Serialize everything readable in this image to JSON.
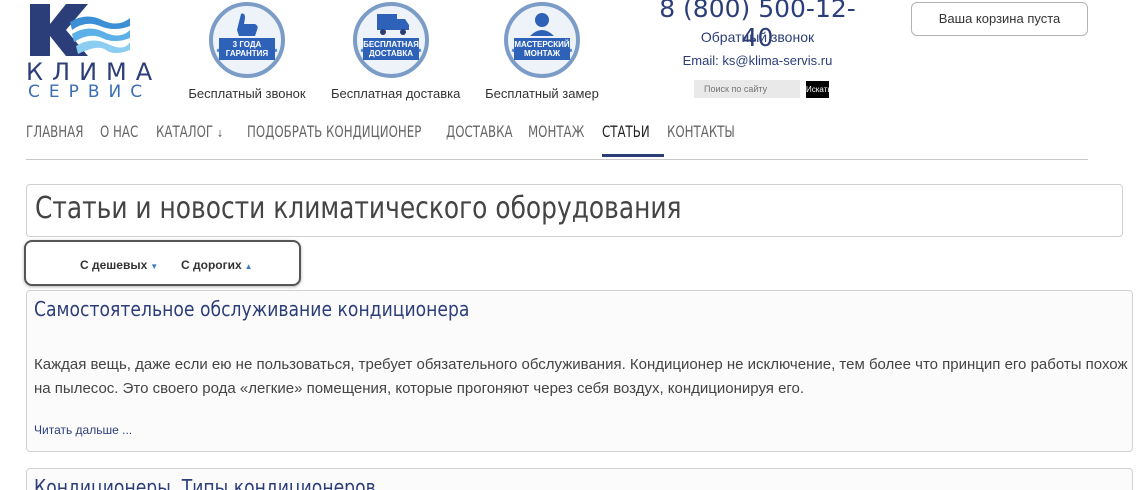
{
  "header": {
    "logo": {
      "line1": "КЛИМА",
      "line2": "СЕРВИС",
      "icon": "klima-servis-logo"
    },
    "badges": [
      {
        "text": "3 ГОДА ГАРАНТИЯ",
        "caption": "Бесплатный звонок",
        "icon": "thumbs-up-icon"
      },
      {
        "text": "БЕСПЛАТНАЯ ДОСТАВКА",
        "caption": "Бесплатная доставка",
        "icon": "truck-icon"
      },
      {
        "text": "МАСТЕРСКИЙ МОНТАЖ",
        "caption": "Бесплатный замер",
        "icon": "worker-icon"
      }
    ],
    "phone": "8 (800) 500-12-40",
    "callback": "Обратный звонок",
    "email": "Email: ks@klima-servis.ru",
    "search": {
      "placeholder": "Поиск по сайту",
      "button": "Искать"
    },
    "cart": "Ваша корзина пуста"
  },
  "nav": {
    "items": [
      "ГЛАВНАЯ",
      "О НАС",
      "КАТАЛОГ",
      "ПОДОБРАТЬ КОНДИЦИОНЕР",
      "ДОСТАВКА",
      "МОНТАЖ",
      "СТАТЬИ",
      "КОНТАКТЫ"
    ],
    "active": "СТАТЬИ"
  },
  "page": {
    "title": "Статьи и новости климатического оборудования",
    "sort": {
      "cheap": "С дешевых",
      "expensive": "С дорогих"
    }
  },
  "articles": [
    {
      "title": "Самостоятельное обслуживание кондиционера",
      "text": "Каждая вещь, даже если ею не пользоваться, требует обязательного обслуживания. Кондиционер не исключение, тем более что принцип его работы похож на пылесос. Это своего рода «легкие» помещения, которые прогоняют через себя воздух, кондиционируя его.",
      "read_more": "Читать дальше ..."
    },
    {
      "title": "Кондиционеры. Типы кондиционеров"
    }
  ],
  "colors": {
    "brand": "#2c3e79",
    "accent": "#2d62b8",
    "badge_ring": "#d0dce9"
  }
}
